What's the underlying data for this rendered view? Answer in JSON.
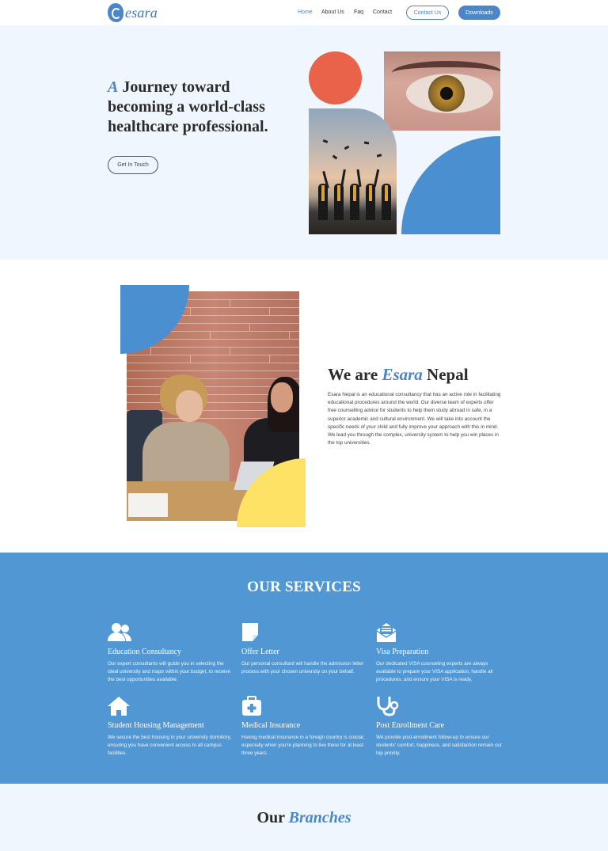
{
  "brand": {
    "logo_text": "esara",
    "logo_icon": "esara-logo-icon"
  },
  "nav": {
    "items": [
      "Home",
      "About Us",
      "Faq",
      "Contact"
    ],
    "active": "Home",
    "contact_button": "Contact Us",
    "downloads_button": "Downloads"
  },
  "hero": {
    "title_accent": "A",
    "title_rest": " Journey toward becoming a world-class healthcare professional.",
    "cta": "Get In Touch"
  },
  "about": {
    "title_prefix": "We are ",
    "title_accent": "Esara",
    "title_suffix": " Nepal",
    "body": "Esara Nepal is an educational consultancy that has an active role in facilitating educational procedures around the world. Our diverse team of experts offer free counselling advice for students to help them study abroad in safe, in a superior academic and cultural environment. We will take into account the specific needs of your child and fully improve your approach with this in mind. We lead you through the complex, university system to help you win places in the top universities."
  },
  "services": {
    "title": "OUR SERVICES",
    "items": [
      {
        "icon": "users-icon",
        "title": "Education Consultancy",
        "text": "Our expert consultants will guide you in selecting the ideal university and major within your budget, to receive the best opportunities available."
      },
      {
        "icon": "note-icon",
        "title": "Offer Letter",
        "text": "Our personal consultant will handle the admission letter process with your chosen university on your behalf."
      },
      {
        "icon": "envelope-open-icon",
        "title": "Visa Preparation",
        "text": "Our dedicated VISA counseling experts are always available to prepare your VISA application, handle all procedures, and ensure your VISA is ready."
      },
      {
        "icon": "home-icon",
        "title": "Student Housing Management",
        "text": "We secure the best housing in your university dormitory, ensuring you have convenient access to all campus facilities."
      },
      {
        "icon": "medical-kit-icon",
        "title": "Medical Insurance",
        "text": "Having medical insurance in a foreign country is crucial, especially when you're planning to live there for at least three years."
      },
      {
        "icon": "stethoscope-icon",
        "title": "Post Enrollment Care",
        "text": "We provide post-enrollment follow-up to ensure our students' comfort, happiness, and satisfaction remain our top priority."
      }
    ]
  },
  "branches": {
    "title_prefix": "Our ",
    "title_accent": "Branches"
  },
  "colors": {
    "accent": "#4a86c8",
    "services_bg": "#5197d3",
    "hero_bg": "#eff6fd",
    "orange": "#e8634a",
    "yellow": "#fde266"
  }
}
